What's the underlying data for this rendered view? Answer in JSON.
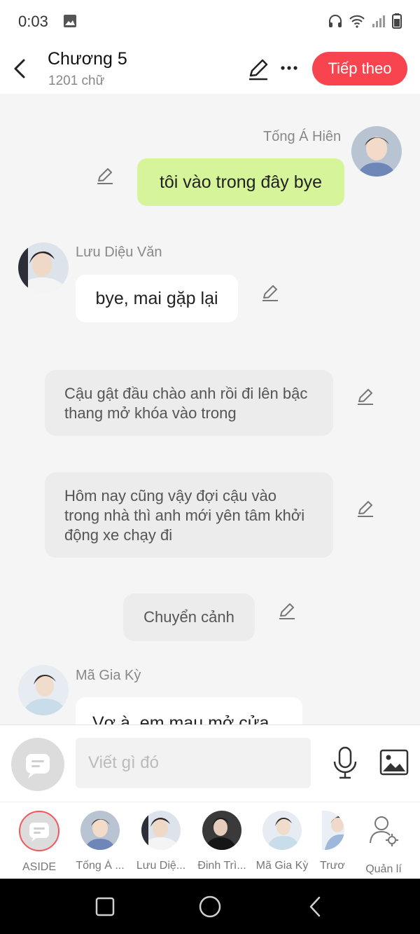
{
  "status": {
    "time": "0:03"
  },
  "header": {
    "title": "Chương 5",
    "word_count": "1201 chữ",
    "next_label": "Tiếp theo"
  },
  "messages": [
    {
      "name": "Tống Á Hiên",
      "text": "tôi vào trong đây bye"
    },
    {
      "name": "Lưu Diệu Văn",
      "text": "bye, mai gặp lại"
    },
    {
      "text": "Cậu gật đầu chào anh rồi đi lên bậc thang mở khóa vào trong"
    },
    {
      "text": "Hôm nay cũng vậy đợi cậu vào trong nhà thì anh mới yên tâm khởi động xe chạy đi"
    },
    {
      "text": "Chuyển cảnh"
    },
    {
      "name": "Mã Gia Kỳ",
      "text": "Vợ à, em mau mở cửa"
    }
  ],
  "input": {
    "placeholder": "Viết gì đó"
  },
  "characters": [
    {
      "label": "ASIDE"
    },
    {
      "label": "Tống Á ..."
    },
    {
      "label": "Lưu Diệ..."
    },
    {
      "label": "Đinh Trì..."
    },
    {
      "label": "Mã Gia Kỳ"
    },
    {
      "label": "Trươ"
    },
    {
      "label": "Quản lí"
    }
  ],
  "colors": {
    "accent": "#f7444e",
    "own_bubble": "#d6f59b",
    "narration": "#ececec"
  }
}
